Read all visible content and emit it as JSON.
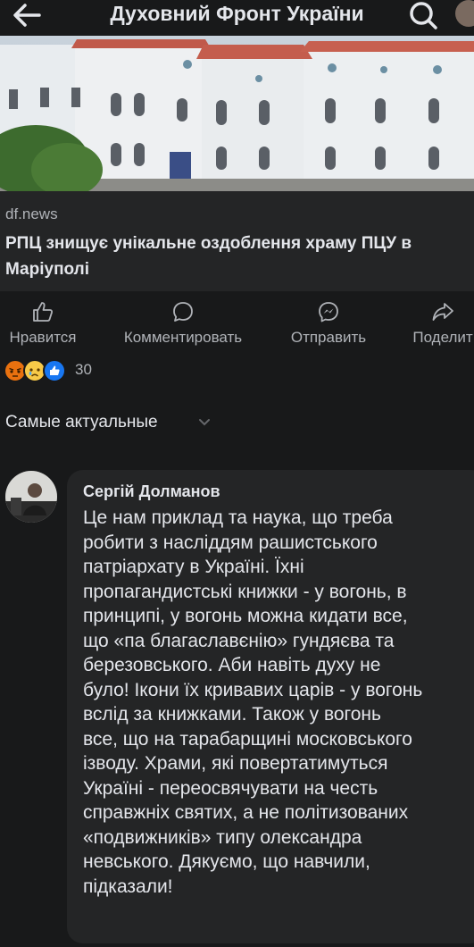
{
  "header": {
    "title": "Духовний Фронт України",
    "back_icon": "arrow-left-icon",
    "search_icon": "search-icon"
  },
  "link": {
    "domain": "df.news",
    "title": "РПЦ знищує унікальне оздоблення храму ПЦУ в Маріуполі"
  },
  "actions": [
    {
      "label": "Нравится",
      "icon": "like-icon"
    },
    {
      "label": "Комментировать",
      "icon": "comment-icon"
    },
    {
      "label": "Отправить",
      "icon": "messenger-icon"
    },
    {
      "label": "Поделит",
      "icon": "share-icon"
    }
  ],
  "reactions": {
    "count": "30",
    "types": [
      "angry",
      "sad",
      "like"
    ]
  },
  "sort": {
    "label": "Самые актуальные"
  },
  "comment": {
    "author": "Сергій Долманов",
    "text": "Це нам приклад та наука, що треба\nробити з насліддям рашистського\nпатріархату в Україні. Їхні\nпропагандистські книжки - у вогонь, в\nпринципі, у вогонь можна кидати все,\nщо «па благаславєнію» гундяєва та\nберезовського. Аби навіть духу не\nбуло! Ікони їх кривавих царів - у вогонь\nвслід за книжками. Також у вогонь\nвсе, що на тарабарщині московського\nізводу. Храми, які повертатимуться\nУкраїні - переосвячувати на честь\nсправжніх святих, а не політизованих\n«подвижників» типу олександра\nневського. Дякуємо, що навчили,\nпідказали!"
  },
  "colors": {
    "background": "#18191a",
    "card": "#242526",
    "text": "#e4e6eb",
    "secondary_text": "#b0b3b8"
  }
}
